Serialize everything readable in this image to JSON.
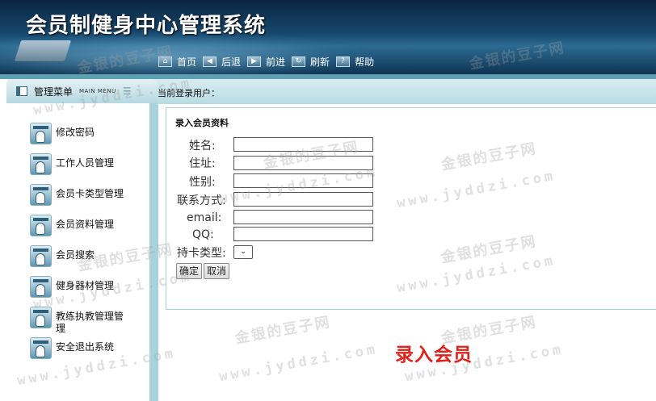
{
  "app": {
    "title": "会员制健身中心管理系统"
  },
  "nav": [
    {
      "label": "首页",
      "glyph": "⌂"
    },
    {
      "label": "后退",
      "glyph": "◀"
    },
    {
      "label": "前进",
      "glyph": "▶"
    },
    {
      "label": "刷新",
      "glyph": "↻"
    },
    {
      "label": "帮助",
      "glyph": "?"
    }
  ],
  "sidebar": {
    "title": "管理菜单",
    "subtitle": "MAIN MENU",
    "items": [
      {
        "label": "修改密码"
      },
      {
        "label": "工作人员管理"
      },
      {
        "label": "会员卡类型管理"
      },
      {
        "label": "会员资料管理"
      },
      {
        "label": "会员搜索"
      },
      {
        "label": "健身器材管理"
      },
      {
        "label": "教练执教管理管理"
      },
      {
        "label": "安全退出系统"
      }
    ]
  },
  "status": {
    "current_user_label": "当前登录用户："
  },
  "form": {
    "title": "录入会员资料",
    "fields": [
      {
        "label": "姓名:",
        "value": ""
      },
      {
        "label": "住址:",
        "value": ""
      },
      {
        "label": "性别:",
        "value": ""
      },
      {
        "label": "联系方式:",
        "value": ""
      },
      {
        "label": "email:",
        "value": ""
      },
      {
        "label": "QQ:",
        "value": ""
      }
    ],
    "card_type_label": "持卡类型:",
    "card_type_selected": "",
    "confirm_label": "确定",
    "cancel_label": "取消"
  },
  "caption": "录入会员",
  "watermark": {
    "cn": "金银的豆子网",
    "en": "www.jyddzi.com"
  }
}
